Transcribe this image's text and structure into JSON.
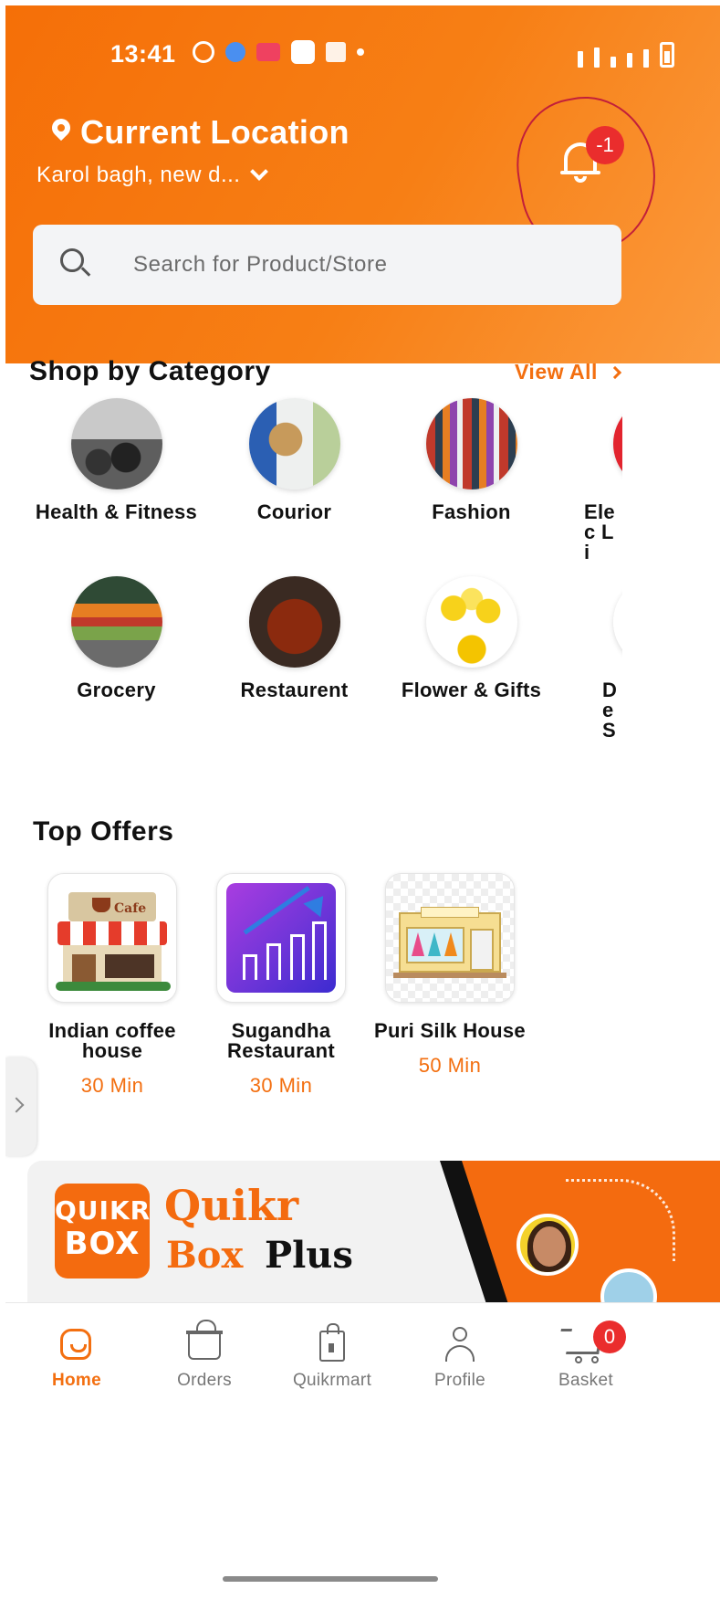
{
  "status_bar": {
    "time": "13:41"
  },
  "header": {
    "location_title": "Current Location",
    "location_value": "Karol bagh, new d...",
    "notification_count": "-1",
    "search_placeholder": "Search for Product/Store",
    "background_color": "#f56f08"
  },
  "categories": {
    "title": "Shop by Category",
    "view_all_label": "View All",
    "items": [
      {
        "label": "Health & Fitness"
      },
      {
        "label": "Courior"
      },
      {
        "label": "Fashion"
      },
      {
        "label": "Elec Li"
      },
      {
        "label": "Grocery"
      },
      {
        "label": "Restaurent"
      },
      {
        "label": "Flower & Gifts"
      },
      {
        "label": "De S"
      }
    ]
  },
  "top_offers": {
    "title": "Top Offers",
    "items": [
      {
        "name": "Indian coffee house",
        "time": "30 Min"
      },
      {
        "name": "Sugandha Restaurant",
        "time": "30 Min"
      },
      {
        "name": "Puri Silk House",
        "time": "50 Min"
      }
    ]
  },
  "banner": {
    "logo_line1": "QUIKR",
    "logo_line2": "BOX",
    "title_line1": "Quikr",
    "title_box": "Box",
    "title_plus": "Plus",
    "accent_color": "#f46b0f"
  },
  "bottom_nav": {
    "items": [
      {
        "label": "Home",
        "icon": "home-icon",
        "active": true
      },
      {
        "label": "Orders",
        "icon": "orders-basket-icon",
        "active": false
      },
      {
        "label": "Quikrmart",
        "icon": "shopping-bag-icon",
        "active": false
      },
      {
        "label": "Profile",
        "icon": "profile-icon",
        "active": false
      },
      {
        "label": "Basket",
        "icon": "cart-icon",
        "active": false
      }
    ],
    "basket_count": "0",
    "active_color": "#f36f10"
  }
}
